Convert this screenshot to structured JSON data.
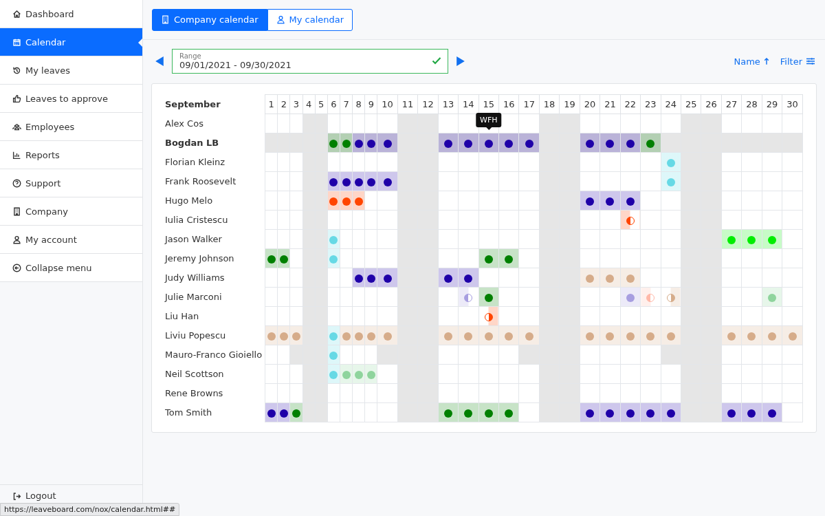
{
  "sidebar": {
    "items": [
      {
        "label": "Dashboard",
        "selected": false
      },
      {
        "label": "Calendar",
        "selected": true
      },
      {
        "label": "My leaves",
        "selected": false
      },
      {
        "label": "Leaves to approve",
        "selected": false
      },
      {
        "label": "Employees",
        "selected": false
      },
      {
        "label": "Reports",
        "selected": false
      },
      {
        "label": "Support",
        "selected": false
      },
      {
        "label": "Company",
        "selected": false
      },
      {
        "label": "My account",
        "selected": false
      },
      {
        "label": "Collapse menu",
        "selected": false
      }
    ],
    "logout": "Logout"
  },
  "tabs": [
    {
      "label": "Company calendar",
      "selected": true
    },
    {
      "label": "My calendar",
      "selected": false
    }
  ],
  "range": {
    "label": "Range",
    "value": "09/01/2021 - 09/30/2021",
    "valid": true
  },
  "sort": {
    "label": "Name"
  },
  "filter": {
    "label": "Filter"
  },
  "calendar": {
    "month": "September",
    "days": [
      {
        "label": "1",
        "weekend": false
      },
      {
        "label": "2",
        "weekend": false
      },
      {
        "label": "3",
        "weekend": false
      },
      {
        "label": "4",
        "weekend": true
      },
      {
        "label": "5",
        "weekend": true
      },
      {
        "label": "6",
        "weekend": false
      },
      {
        "label": "7",
        "weekend": false
      },
      {
        "label": "8",
        "weekend": false
      },
      {
        "label": "9",
        "weekend": false
      },
      {
        "label": "10",
        "weekend": false
      },
      {
        "label": "11",
        "weekend": true
      },
      {
        "label": "12",
        "weekend": true
      },
      {
        "label": "13",
        "weekend": false
      },
      {
        "label": "14",
        "weekend": false
      },
      {
        "label": "15",
        "weekend": false
      },
      {
        "label": "16",
        "weekend": false
      },
      {
        "label": "17",
        "weekend": false
      },
      {
        "label": "18",
        "weekend": true
      },
      {
        "label": "19",
        "weekend": true
      },
      {
        "label": "20",
        "weekend": false
      },
      {
        "label": "21",
        "weekend": false
      },
      {
        "label": "22",
        "weekend": false
      },
      {
        "label": "23",
        "weekend": false
      },
      {
        "label": "24",
        "weekend": false
      },
      {
        "label": "25",
        "weekend": true
      },
      {
        "label": "26",
        "weekend": true
      },
      {
        "label": "27",
        "weekend": false
      },
      {
        "label": "28",
        "weekend": false
      },
      {
        "label": "29",
        "weekend": false
      },
      {
        "label": "30",
        "weekend": false
      }
    ],
    "rows": [
      {
        "name": "Alex Cos",
        "highlighted": false,
        "cells": [
          null,
          null,
          null,
          null,
          null,
          null,
          null,
          null,
          null,
          null,
          null,
          null,
          null,
          null,
          null,
          null,
          null,
          null,
          null,
          null,
          null,
          null,
          null,
          null,
          null,
          null,
          null,
          null,
          null,
          null
        ]
      },
      {
        "name": "Bogdan LB",
        "highlighted": true,
        "cells": [
          null,
          null,
          null,
          null,
          null,
          {
            "color": "#008000"
          },
          {
            "color": "#008000"
          },
          {
            "color": "#1f00a8"
          },
          {
            "color": "#1f00a8"
          },
          {
            "color": "#1f00a8"
          },
          null,
          null,
          {
            "color": "#1f00a8"
          },
          {
            "color": "#1f00a8"
          },
          {
            "color": "#1f00a8",
            "tooltip": "WFH"
          },
          {
            "color": "#1f00a8"
          },
          {
            "color": "#1f00a8"
          },
          null,
          null,
          {
            "color": "#1f00a8"
          },
          {
            "color": "#1f00a8"
          },
          {
            "color": "#1f00a8"
          },
          {
            "color": "#008000"
          },
          null,
          null,
          null,
          null,
          null,
          null,
          null
        ]
      },
      {
        "name": "Florian Kleinz",
        "highlighted": false,
        "cells": [
          null,
          null,
          null,
          null,
          null,
          null,
          null,
          null,
          null,
          null,
          null,
          null,
          null,
          null,
          null,
          null,
          null,
          null,
          null,
          null,
          null,
          null,
          null,
          {
            "color": "#66d9e5"
          },
          null,
          null,
          null,
          null,
          null,
          null
        ]
      },
      {
        "name": "Frank Roosevelt",
        "highlighted": false,
        "cells": [
          null,
          null,
          null,
          null,
          null,
          {
            "color": "#1f00a8"
          },
          {
            "color": "#1f00a8"
          },
          {
            "color": "#1f00a8"
          },
          {
            "color": "#1f00a8"
          },
          {
            "color": "#1f00a8"
          },
          null,
          null,
          null,
          null,
          null,
          null,
          null,
          null,
          null,
          null,
          null,
          null,
          null,
          {
            "color": "#66d9e5"
          },
          null,
          null,
          null,
          null,
          null,
          null
        ]
      },
      {
        "name": "Hugo Melo",
        "highlighted": false,
        "cells": [
          null,
          null,
          null,
          null,
          null,
          {
            "color": "#ff4500"
          },
          {
            "color": "#ff4500"
          },
          {
            "color": "#ff4500"
          },
          null,
          null,
          null,
          null,
          null,
          null,
          null,
          null,
          null,
          null,
          null,
          {
            "color": "#1f00a8"
          },
          {
            "color": "#1f00a8"
          },
          {
            "color": "#1f00a8"
          },
          null,
          null,
          null,
          null,
          null,
          null,
          null,
          null
        ]
      },
      {
        "name": "Iulia Cristescu",
        "highlighted": false,
        "cells": [
          null,
          null,
          null,
          null,
          null,
          null,
          null,
          null,
          null,
          null,
          null,
          null,
          null,
          null,
          null,
          null,
          null,
          null,
          null,
          null,
          null,
          {
            "color": "#ff4500",
            "kind": "morning"
          },
          null,
          null,
          null,
          null,
          null,
          null,
          null,
          null
        ]
      },
      {
        "name": "Jason Walker",
        "highlighted": false,
        "cells": [
          null,
          null,
          null,
          null,
          null,
          {
            "color": "#66d9e5"
          },
          null,
          null,
          null,
          null,
          null,
          null,
          null,
          null,
          null,
          null,
          null,
          null,
          null,
          null,
          null,
          null,
          null,
          null,
          null,
          null,
          {
            "color": "#00ee00"
          },
          {
            "color": "#00ee00"
          },
          {
            "color": "#00ee00"
          },
          null
        ]
      },
      {
        "name": "Jeremy Johnson",
        "highlighted": false,
        "cells": [
          {
            "color": "#008000"
          },
          {
            "color": "#008000"
          },
          null,
          null,
          null,
          {
            "color": "#66d9e5"
          },
          null,
          null,
          null,
          null,
          null,
          null,
          null,
          null,
          {
            "color": "#008000"
          },
          {
            "color": "#008000"
          },
          null,
          null,
          null,
          null,
          null,
          null,
          null,
          null,
          null,
          null,
          null,
          null,
          null,
          null
        ]
      },
      {
        "name": "Judy Williams",
        "highlighted": false,
        "cells": [
          null,
          null,
          null,
          null,
          null,
          null,
          null,
          {
            "color": "#1f00a8"
          },
          {
            "color": "#1f00a8"
          },
          {
            "color": "#1f00a8"
          },
          null,
          null,
          {
            "color": "#1f00a8"
          },
          {
            "color": "#1f00a8"
          },
          null,
          null,
          null,
          null,
          null,
          {
            "color": "#d6ac8a"
          },
          {
            "color": "#d6ac8a"
          },
          {
            "color": "#d6ac8a"
          },
          null,
          null,
          null,
          null,
          null,
          null,
          null,
          null
        ]
      },
      {
        "name": "Julie Marconi",
        "highlighted": false,
        "cells": [
          null,
          null,
          null,
          null,
          null,
          null,
          null,
          null,
          null,
          null,
          null,
          null,
          null,
          {
            "color": "#a79ee0",
            "kind": "morning"
          },
          {
            "color": "#008000"
          },
          null,
          null,
          null,
          null,
          null,
          null,
          {
            "color": "#a79ee0"
          },
          {
            "color": "#ffb8a8",
            "kind": "morning"
          },
          {
            "color": "#d6ac8a",
            "kind": "afternoon"
          },
          null,
          null,
          null,
          null,
          {
            "color": "#8fd49d"
          },
          null
        ]
      },
      {
        "name": "Liu Han",
        "highlighted": false,
        "cells": [
          null,
          null,
          null,
          null,
          null,
          null,
          null,
          null,
          null,
          null,
          null,
          null,
          null,
          null,
          {
            "color": "#ff4500",
            "kind": "afternoon"
          },
          null,
          null,
          null,
          null,
          null,
          null,
          null,
          null,
          null,
          null,
          null,
          null,
          null,
          null,
          null
        ]
      },
      {
        "name": "Liviu Popescu",
        "highlighted": false,
        "cells": [
          {
            "color": "#d6ac8a"
          },
          {
            "color": "#d6ac8a"
          },
          {
            "color": "#d6ac8a"
          },
          null,
          null,
          {
            "color": "#66d9e5"
          },
          {
            "color": "#d6ac8a"
          },
          {
            "color": "#d6ac8a"
          },
          {
            "color": "#d6ac8a"
          },
          {
            "color": "#d6ac8a"
          },
          null,
          null,
          {
            "color": "#d6ac8a"
          },
          {
            "color": "#d6ac8a"
          },
          {
            "color": "#d6ac8a"
          },
          {
            "color": "#d6ac8a"
          },
          {
            "color": "#d6ac8a"
          },
          null,
          null,
          {
            "color": "#d6ac8a"
          },
          {
            "color": "#d6ac8a"
          },
          {
            "color": "#d6ac8a"
          },
          {
            "color": "#d6ac8a"
          },
          {
            "color": "#d6ac8a"
          },
          null,
          null,
          {
            "color": "#d6ac8a"
          },
          {
            "color": "#d6ac8a"
          },
          {
            "color": "#d6ac8a"
          },
          {
            "color": "#d6ac8a"
          }
        ]
      },
      {
        "name": "Mauro-Franco Gioiello",
        "highlighted": false,
        "cells": [
          null,
          null,
          {
            "off": true
          },
          null,
          null,
          {
            "color": "#66d9e5"
          },
          null,
          null,
          null,
          {
            "off": true
          },
          null,
          null,
          null,
          null,
          null,
          null,
          {
            "off": true
          },
          null,
          null,
          null,
          null,
          null,
          null,
          {
            "off": true
          },
          null,
          null,
          null,
          null,
          null,
          null
        ]
      },
      {
        "name": "Neil Scottson",
        "highlighted": false,
        "cells": [
          null,
          null,
          null,
          null,
          null,
          {
            "color": "#66d9e5"
          },
          {
            "color": "#8fd49d"
          },
          {
            "color": "#8fd49d"
          },
          {
            "color": "#8fd49d"
          },
          null,
          null,
          null,
          null,
          null,
          null,
          null,
          null,
          null,
          null,
          null,
          null,
          null,
          null,
          null,
          null,
          null,
          null,
          null,
          null,
          null
        ]
      },
      {
        "name": "Rene Browns",
        "highlighted": false,
        "cells": [
          null,
          null,
          null,
          null,
          null,
          null,
          null,
          null,
          null,
          null,
          null,
          null,
          null,
          null,
          null,
          null,
          null,
          null,
          null,
          null,
          null,
          null,
          null,
          null,
          null,
          null,
          null,
          null,
          null,
          null
        ]
      },
      {
        "name": "Tom Smith",
        "highlighted": false,
        "cells": [
          {
            "color": "#1f00a8"
          },
          {
            "color": "#1f00a8"
          },
          {
            "color": "#008000"
          },
          null,
          null,
          null,
          null,
          null,
          null,
          null,
          null,
          null,
          {
            "color": "#008000"
          },
          {
            "color": "#008000"
          },
          {
            "color": "#008000"
          },
          {
            "color": "#008000"
          },
          null,
          null,
          null,
          {
            "color": "#1f00a8"
          },
          {
            "color": "#1f00a8"
          },
          {
            "color": "#1f00a8"
          },
          {
            "color": "#1f00a8"
          },
          {
            "color": "#1f00a8"
          },
          null,
          null,
          {
            "color": "#1f00a8"
          },
          {
            "color": "#1f00a8"
          },
          {
            "color": "#1f00a8"
          },
          null
        ]
      }
    ]
  },
  "status_bar": {
    "url": "https://leaveboard.com/nox/calendar.html##"
  }
}
